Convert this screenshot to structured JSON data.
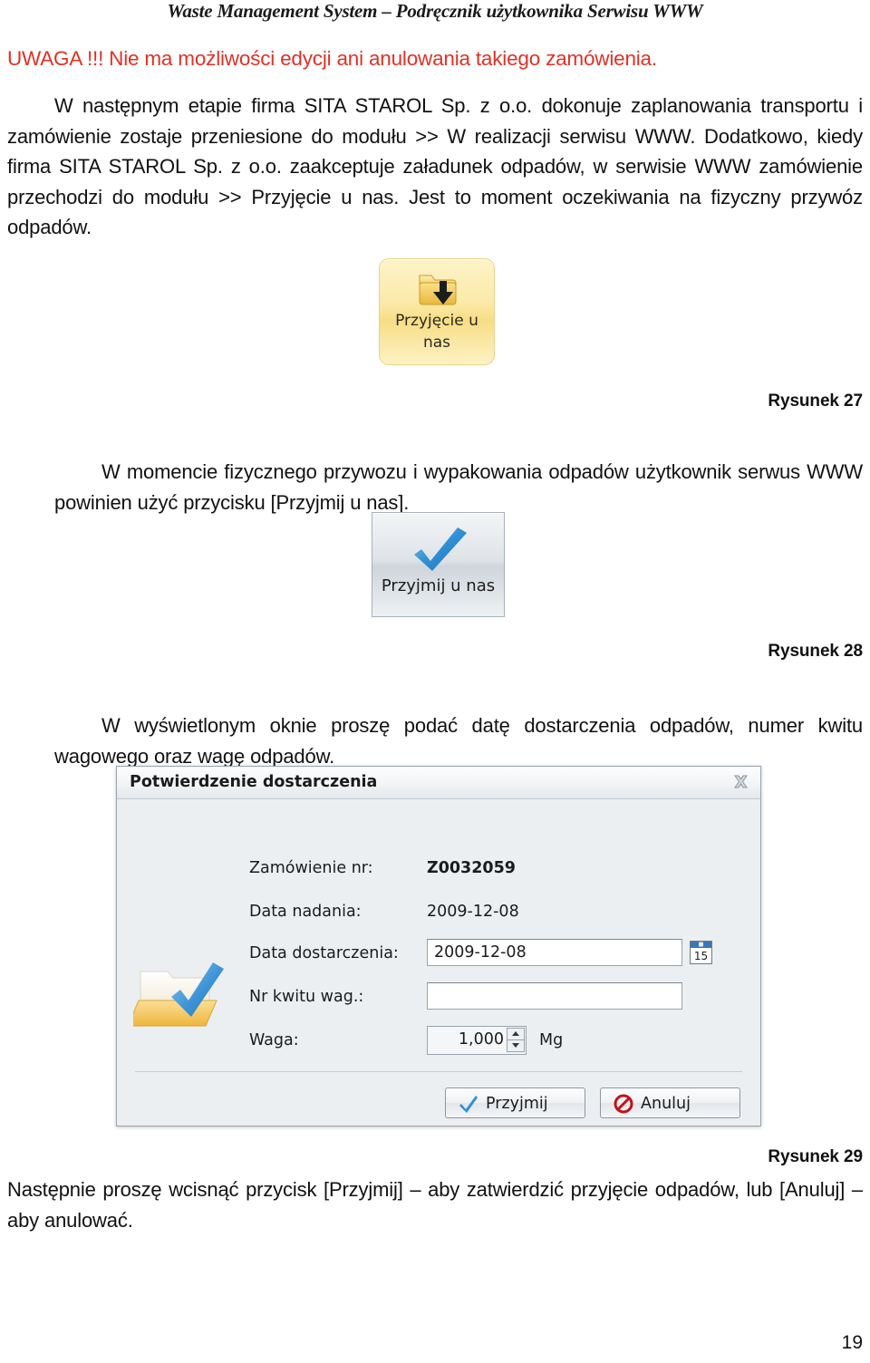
{
  "header": {
    "running_title": "Waste Management System – Podręcznik użytkownika Serwisu WWW"
  },
  "page": {
    "number": "19",
    "warning": "UWAGA !!! Nie ma możliwości edycji ani anulowania takiego zamówienia.",
    "paragraphs": {
      "p1": "W następnym etapie firma SITA STAROL Sp. z o.o. dokonuje zaplanowania transportu i zamówienie zostaje przeniesione do modułu >> W realizacji serwisu WWW. Dodatkowo, kiedy firma SITA STAROL Sp. z o.o. zaakceptuje załadunek odpadów, w serwisie WWW zamówienie przechodzi do modułu >> Przyjęcie u nas. Jest to moment oczekiwania na fizyczny przywóz odpadów.",
      "p2": "W momencie fizycznego przywozu i wypakowania odpadów użytkownik serwus WWW powinien użyć przycisku [Przyjmij u nas].",
      "p3": "W wyświetlonym oknie proszę podać datę dostarczenia odpadów, numer kwitu wagowego oraz wagę odpadów.",
      "p4": "Następnie proszę wcisnąć przycisk [Przyjmij] – aby zatwierdzić przyjęcie odpadów, lub [Anuluj] – aby anulować."
    },
    "captions": {
      "fig27": "Rysunek 27",
      "fig28": "Rysunek 28",
      "fig29": "Rysunek 29"
    }
  },
  "figure27": {
    "icon": "folder-download-icon",
    "label": "Przyjęcie u nas",
    "label_line1": "Przyjęcie u",
    "label_line2": "nas",
    "background_color": "#fbeaa8"
  },
  "figure28": {
    "icon": "blue-check-icon",
    "label": "Przyjmij u nas",
    "background_color": "#dfe3e8"
  },
  "figure29": {
    "dialog": {
      "title": "Potwierdzenie dostarczenia",
      "close_icon": "close-icon",
      "side_icon": "folder-check-icon",
      "fields": [
        {
          "label": "Zamówienie nr:",
          "value": "Z0032059",
          "type": "static-bold"
        },
        {
          "label": "Data nadania:",
          "value": "2009-12-08",
          "type": "static"
        },
        {
          "label": "Data dostarczenia:",
          "value": "2009-12-08",
          "type": "date-input",
          "button_icon": "calendar-icon",
          "calendar_day": "15"
        },
        {
          "label": "Nr kwitu wag.:",
          "value": "",
          "type": "text-input"
        },
        {
          "label": "Waga:",
          "value": "1,000",
          "type": "spinner",
          "unit": "Mg"
        }
      ],
      "buttons": [
        {
          "label": "Przyjmij",
          "icon": "check-icon"
        },
        {
          "label": "Anuluj",
          "icon": "prohibition-icon"
        }
      ]
    }
  }
}
